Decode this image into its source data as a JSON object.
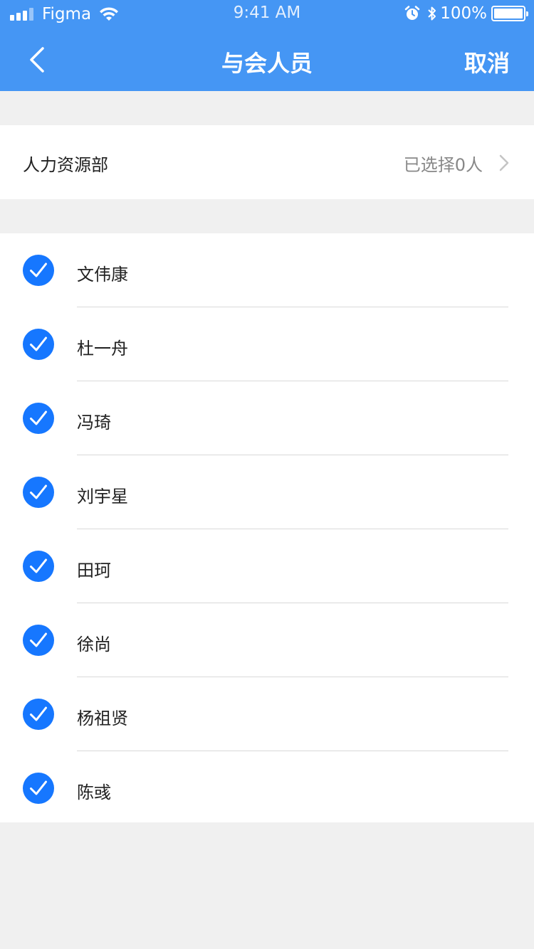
{
  "status_bar": {
    "carrier": "Figma",
    "time": "9:41 AM",
    "battery": "100%"
  },
  "nav": {
    "title": "与会人员",
    "cancel_label": "取消"
  },
  "department": {
    "name": "人力资源部",
    "selected_text": "已选择0人"
  },
  "attendees": [
    {
      "name": "文伟康",
      "checked": true
    },
    {
      "name": "杜一舟",
      "checked": true
    },
    {
      "name": "冯琦",
      "checked": true
    },
    {
      "name": "刘宇星",
      "checked": true
    },
    {
      "name": "田珂",
      "checked": true
    },
    {
      "name": "徐尚",
      "checked": true
    },
    {
      "name": "杨祖贤",
      "checked": true
    },
    {
      "name": "陈彧",
      "checked": true
    }
  ],
  "colors": {
    "header": "#4596f4",
    "check": "#1677ff",
    "background": "#f0f0f0"
  }
}
